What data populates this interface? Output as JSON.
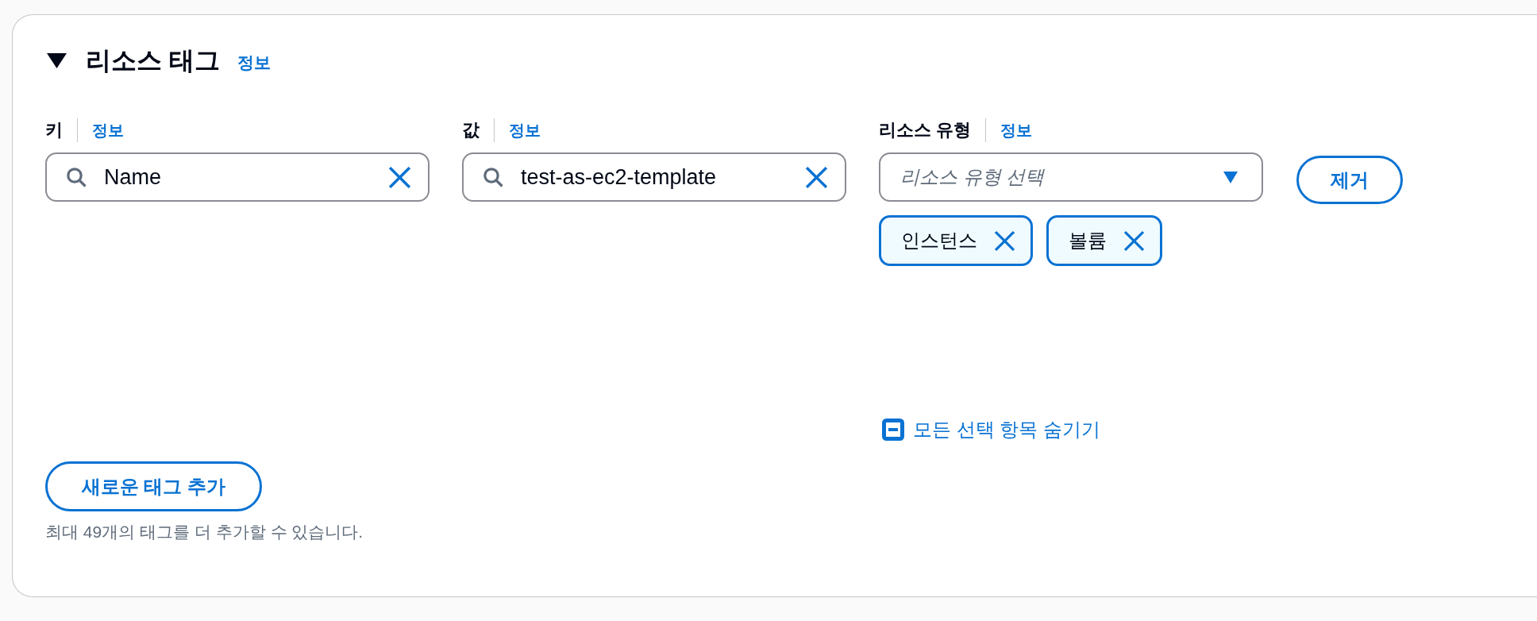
{
  "section": {
    "title": "리소스 태그",
    "expanded": true,
    "info_link": "정보"
  },
  "tags": [
    {
      "key": {
        "label": "키",
        "info_link": "정보",
        "value": "Name"
      },
      "value": {
        "label": "값",
        "info_link": "정보",
        "value": "test-as-ec2-template"
      },
      "resource_type": {
        "label": "리소스 유형",
        "info_link": "정보",
        "placeholder": "리소스 유형 선택",
        "tokens": [
          {
            "label": "인스턴스"
          },
          {
            "label": "볼륨"
          }
        ],
        "hide_link": "모든 선택 항목 숨기기"
      },
      "remove_button": "제거"
    }
  ],
  "add_button": "새로운 태그 추가",
  "hint": "최대 49개의 태그를 더 추가할 수 있습니다."
}
